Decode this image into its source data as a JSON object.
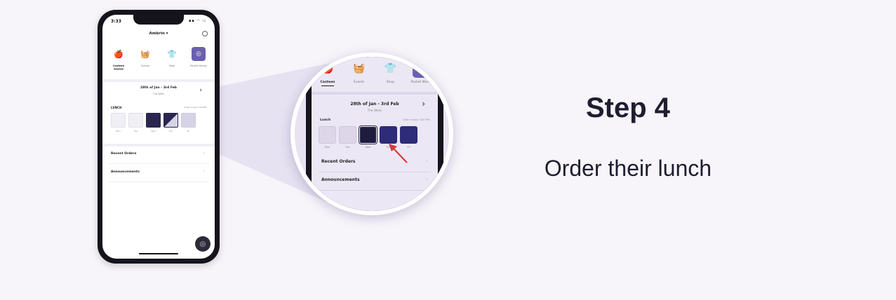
{
  "step": {
    "title": "Step 4",
    "subtitle": "Order their lunch"
  },
  "phone": {
    "status_time": "3:33",
    "status_icons": "▪▪ ◠ ▭",
    "user_name": "Ambrin ▾",
    "tabs": [
      {
        "label": "Canteen",
        "icon": "apple-icon",
        "glyph": "🍎",
        "selected": true
      },
      {
        "label": "Events",
        "icon": "basket-icon",
        "glyph": "🧺",
        "selected": false
      },
      {
        "label": "Shop",
        "icon": "shirt-icon",
        "glyph": "👕",
        "selected": false
      },
      {
        "label": "Pocket Money",
        "icon": "wallet-icon",
        "glyph": "◎",
        "selected": false,
        "active": true
      }
    ],
    "date_range": "28th of Jan - 3rd Feb",
    "date_sub": "This Week",
    "lunch": {
      "title": "LUNCH",
      "note": "Order closes 3:00 PM",
      "days": [
        {
          "label": "Mon",
          "state": "empty"
        },
        {
          "label": "Tue",
          "state": "empty"
        },
        {
          "label": "Wed",
          "state": "filled"
        },
        {
          "label": "Thu",
          "state": "partial"
        },
        {
          "label": "Fri",
          "state": "light"
        }
      ]
    },
    "rows": [
      "Recent Orders",
      "Announcements"
    ],
    "fab_glyph": "◎"
  },
  "zoom": {
    "tabs": [
      {
        "label": "Canteen",
        "icon": "apple-icon",
        "glyph": "🍎",
        "selected": true
      },
      {
        "label": "Events",
        "icon": "basket-icon",
        "glyph": "🧺",
        "selected": false
      },
      {
        "label": "Shop",
        "icon": "shirt-icon",
        "glyph": "👕",
        "selected": false
      },
      {
        "label": "Pocket Money",
        "icon": "wallet-icon",
        "glyph": "◎",
        "selected": false,
        "active": true
      }
    ],
    "date_range": "28th of Jan - 3rd Feb",
    "date_sub": "This Week",
    "lunch_title": "Lunch",
    "lunch_note": "Order closes 3:00 PM",
    "days": [
      {
        "label": "Mon",
        "state": "empty"
      },
      {
        "label": "Tue",
        "state": "empty"
      },
      {
        "label": "Wed",
        "state": "selected"
      },
      {
        "label": "Thu",
        "state": "blue"
      },
      {
        "label": "Fri",
        "state": "blue"
      }
    ],
    "rows": [
      "Recent Orders",
      "Announcements"
    ]
  },
  "colors": {
    "accent": "#6b5fb0",
    "navy": "#2a2650",
    "background": "#f7f5fa",
    "pointer": "#d63a3a"
  }
}
